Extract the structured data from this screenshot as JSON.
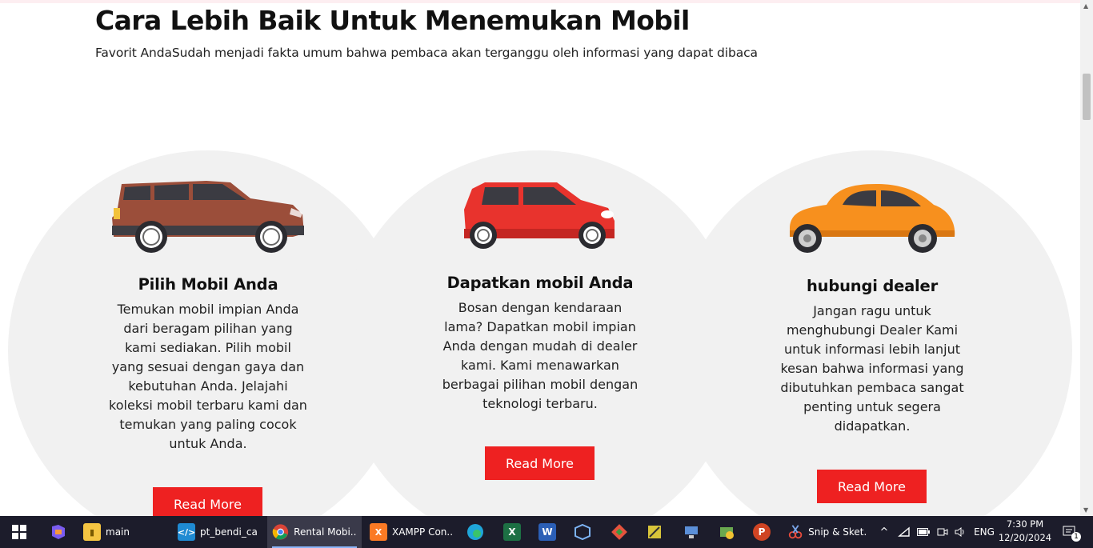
{
  "section": {
    "heading": "Cara Lebih Baik Untuk Menemukan Mobil",
    "subheading": "Favorit AndaSudah menjadi fakta umum bahwa pembaca akan terganggu oleh informasi yang dapat dibaca"
  },
  "cards": [
    {
      "title": "Pilih Mobil Anda",
      "lines": [
        "Temukan mobil impian Anda",
        "dari beragam pilihan yang",
        "kami sediakan. Pilih mobil",
        "yang sesuai dengan gaya dan",
        "kebutuhan Anda. Jelajahi",
        "koleksi mobil terbaru kami dan",
        "temukan yang paling cocok",
        "untuk Anda."
      ],
      "button": "Read More",
      "car_icon": "suv-car-icon",
      "car_color": "#9b4e3a"
    },
    {
      "title": "Dapatkan mobil Anda",
      "lines": [
        "Bosan dengan kendaraan",
        "lama? Dapatkan mobil impian",
        "Anda dengan mudah di dealer",
        "kami. Kami menawarkan",
        "berbagai pilihan mobil dengan",
        "teknologi terbaru."
      ],
      "button": "Read More",
      "car_icon": "hatchback-car-icon",
      "car_color": "#e8332d"
    },
    {
      "title": "hubungi dealer",
      "lines": [
        "Jangan ragu untuk",
        "menghubungi Dealer Kami",
        "untuk informasi lebih lanjut",
        "kesan bahwa informasi yang",
        "dibutuhkan pembaca sangat",
        "penting untuk segera",
        "didapatkan."
      ],
      "button": "Read More",
      "car_icon": "beetle-car-icon",
      "car_color": "#f7901e"
    }
  ],
  "colors": {
    "accent": "#ee2121",
    "circle_bg": "#f1f1f1",
    "taskbar_bg": "#1c1c2b"
  },
  "taskbar": {
    "apps": [
      {
        "label": "main",
        "icon": "folder-icon"
      },
      {
        "label": "pt_bendi_ca...",
        "icon": "vscode-icon"
      },
      {
        "label": "Rental Mobi...",
        "icon": "chrome-icon"
      },
      {
        "label": "XAMPP Con...",
        "icon": "xampp-icon"
      },
      {
        "label": "Snip & Sket...",
        "icon": "snip-sketch-icon"
      }
    ],
    "language": "ENG",
    "time": "7:30 PM",
    "date": "12/20/2024",
    "notification_count": "1"
  }
}
